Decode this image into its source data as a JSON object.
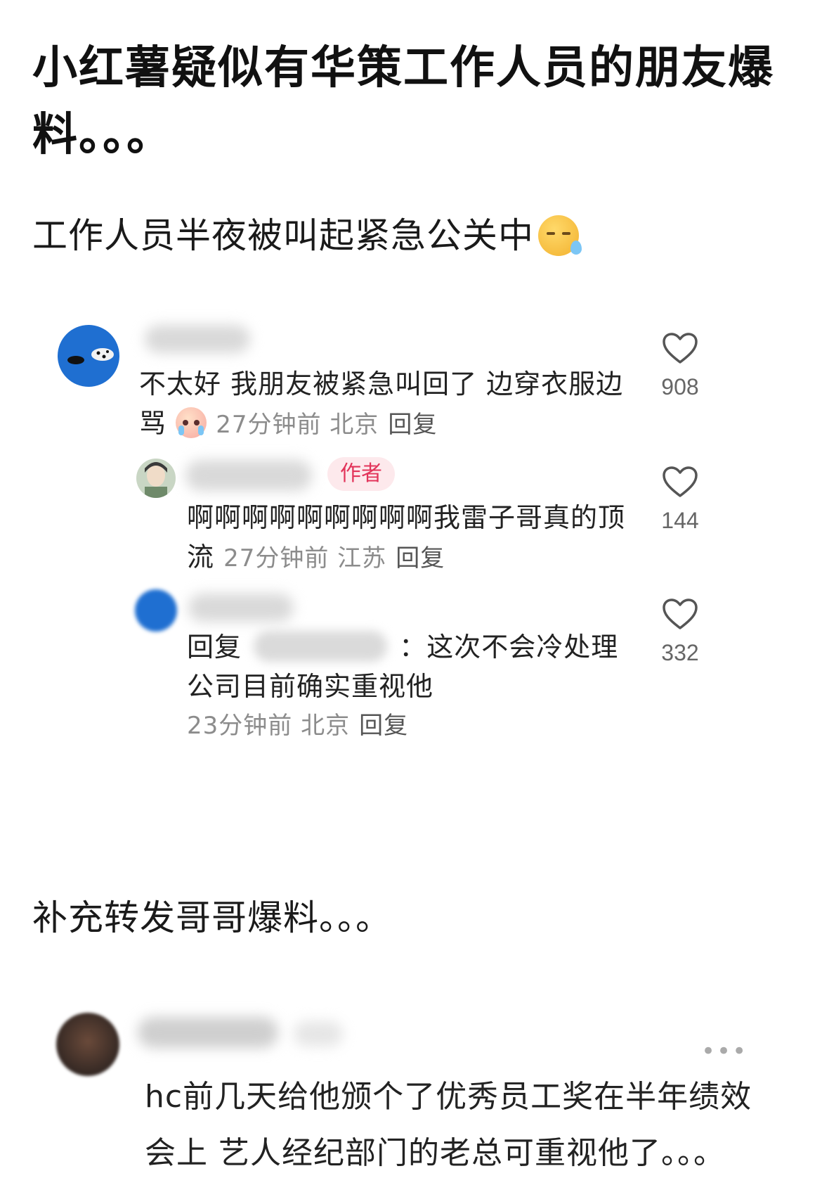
{
  "post": {
    "title": "小红薯疑似有华策工作人员的朋友爆料。。。",
    "subtitle": "工作人员半夜被叫起紧急公关中",
    "section2": "补充转发哥哥爆料。。。"
  },
  "comments": [
    {
      "text_line1": "不太好 我朋友被紧急叫回了 边穿衣服边",
      "text_line2": "骂",
      "meta": "27分钟前 北京",
      "reply": "回复",
      "likes": "908"
    },
    {
      "tag": "作者",
      "text_line1": "啊啊啊啊啊啊啊啊啊我雷子哥真的顶",
      "text_line2": "流",
      "meta": "27分钟前 江苏",
      "reply": "回复",
      "likes": "144"
    },
    {
      "reply_prefix": "回复",
      "text_line1": "：这次不会冷处理",
      "text_line2": "公司目前确实重视他",
      "meta": "23分钟前 北京",
      "reply": "回复",
      "likes": "332"
    }
  ],
  "comment2": {
    "line1": "hc前几天给他颁个了优秀员工奖在半年绩效",
    "line2": "会上 艺人经纪部门的老总可重视他了。。。",
    "more": "•••"
  },
  "icons": {
    "sleepy": "sleepy-face-icon",
    "crying": "crying-face-icon",
    "heart": "heart-outline-icon",
    "more": "more-dots-icon"
  },
  "colors": {
    "author_tag_text": "#e2345a",
    "author_tag_bg": "#fde9ec",
    "meta": "#8c8c8c",
    "avatar_blue": "#1f6fd1"
  }
}
